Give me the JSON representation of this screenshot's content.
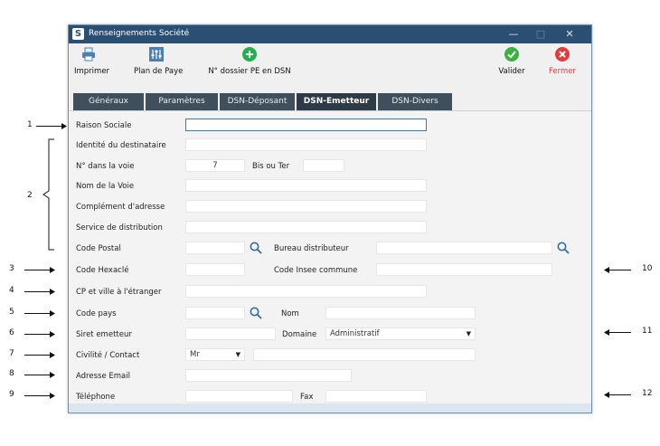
{
  "window": {
    "title": "Renseignements Société",
    "app_icon_letter": "S",
    "controls": {
      "minimize": "—",
      "maximize": "□",
      "close": "✕"
    }
  },
  "toolbar": {
    "print_label": "Imprimer",
    "plan_label": "Plan de Paye",
    "dossier_label": "N° dossier PE en DSN",
    "validate_label": "Valider",
    "close_label": "Fermer"
  },
  "tabs": [
    {
      "label": "Généraux",
      "active": false
    },
    {
      "label": "Paramètres",
      "active": false
    },
    {
      "label": "DSN-Déposant",
      "active": false
    },
    {
      "label": "DSN-Emetteur",
      "active": true
    },
    {
      "label": "DSN-Divers",
      "active": false
    }
  ],
  "form": {
    "raison_sociale": {
      "label": "Raison Sociale",
      "value": ""
    },
    "identite_destinataire": {
      "label": "Identité du destinataire",
      "value": ""
    },
    "numero_voie": {
      "label": "N° dans la voie",
      "value": "7"
    },
    "bis_ter": {
      "label": "Bis ou Ter",
      "value": ""
    },
    "nom_voie": {
      "label": "Nom de la Voie",
      "value": ""
    },
    "complement_adresse": {
      "label": "Complément d'adresse",
      "value": ""
    },
    "service_distribution": {
      "label": "Service de distribution",
      "value": ""
    },
    "code_postal": {
      "label": "Code Postal",
      "value": ""
    },
    "bureau_distributeur": {
      "label": "Bureau distributeur",
      "value": ""
    },
    "code_hexacle": {
      "label": "Code Hexaclé",
      "value": ""
    },
    "code_insee": {
      "label": "Code Insee commune",
      "value": ""
    },
    "cp_ville_etranger": {
      "label": "CP et ville à l'étranger",
      "value": ""
    },
    "code_pays": {
      "label": "Code pays",
      "value": ""
    },
    "nom": {
      "label": "Nom",
      "value": ""
    },
    "siret_emetteur": {
      "label": "Siret emetteur",
      "value": ""
    },
    "domaine": {
      "label": "Domaine",
      "value": "Administratif"
    },
    "civilite_contact": {
      "label": "Civilité / Contact",
      "civilite": "Mr",
      "contact": ""
    },
    "adresse_email": {
      "label": "Adresse Email",
      "value": ""
    },
    "telephone": {
      "label": "Téléphone",
      "value": ""
    },
    "fax": {
      "label": "Fax",
      "value": ""
    }
  },
  "annotations": {
    "left": [
      "1",
      "2",
      "3",
      "4",
      "5",
      "6",
      "7",
      "8",
      "9"
    ],
    "right": [
      "10",
      "11",
      "12"
    ]
  },
  "colors": {
    "titlebar": "#2b4f73",
    "tab_bg": "#3f4f5c",
    "tab_active": "#2e3b46",
    "validate_green": "#3cb043",
    "close_red": "#e23b3b",
    "add_green": "#21b04b",
    "print_blue": "#4d7fb0"
  }
}
